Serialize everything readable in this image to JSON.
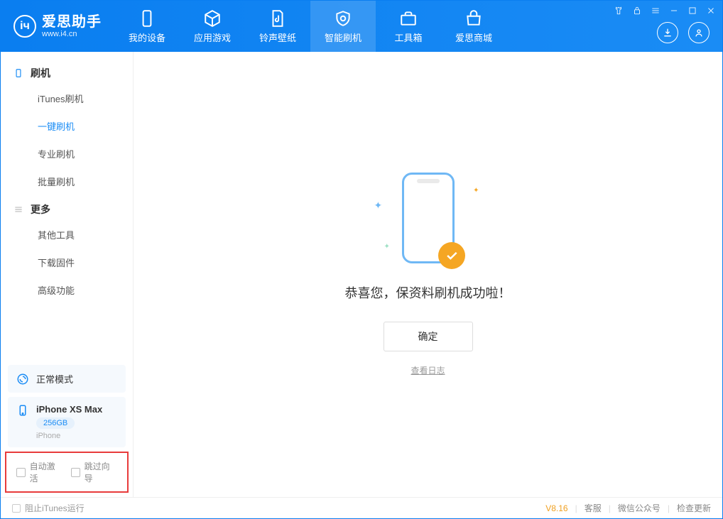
{
  "app": {
    "title": "爱思助手",
    "url": "www.i4.cn"
  },
  "tabs": [
    {
      "label": "我的设备"
    },
    {
      "label": "应用游戏"
    },
    {
      "label": "铃声壁纸"
    },
    {
      "label": "智能刷机"
    },
    {
      "label": "工具箱"
    },
    {
      "label": "爱思商城"
    }
  ],
  "sidebar": {
    "group1": {
      "title": "刷机",
      "items": [
        "iTunes刷机",
        "一键刷机",
        "专业刷机",
        "批量刷机"
      ]
    },
    "group2": {
      "title": "更多",
      "items": [
        "其他工具",
        "下载固件",
        "高级功能"
      ]
    },
    "mode_label": "正常模式",
    "device": {
      "name": "iPhone XS Max",
      "storage": "256GB",
      "type": "iPhone"
    },
    "check1": "自动激活",
    "check2": "跳过向导"
  },
  "main": {
    "success_text": "恭喜您，保资料刷机成功啦！",
    "ok_button": "确定",
    "view_log": "查看日志"
  },
  "statusbar": {
    "block_itunes": "阻止iTunes运行",
    "version": "V8.16",
    "links": [
      "客服",
      "微信公众号",
      "检查更新"
    ]
  }
}
